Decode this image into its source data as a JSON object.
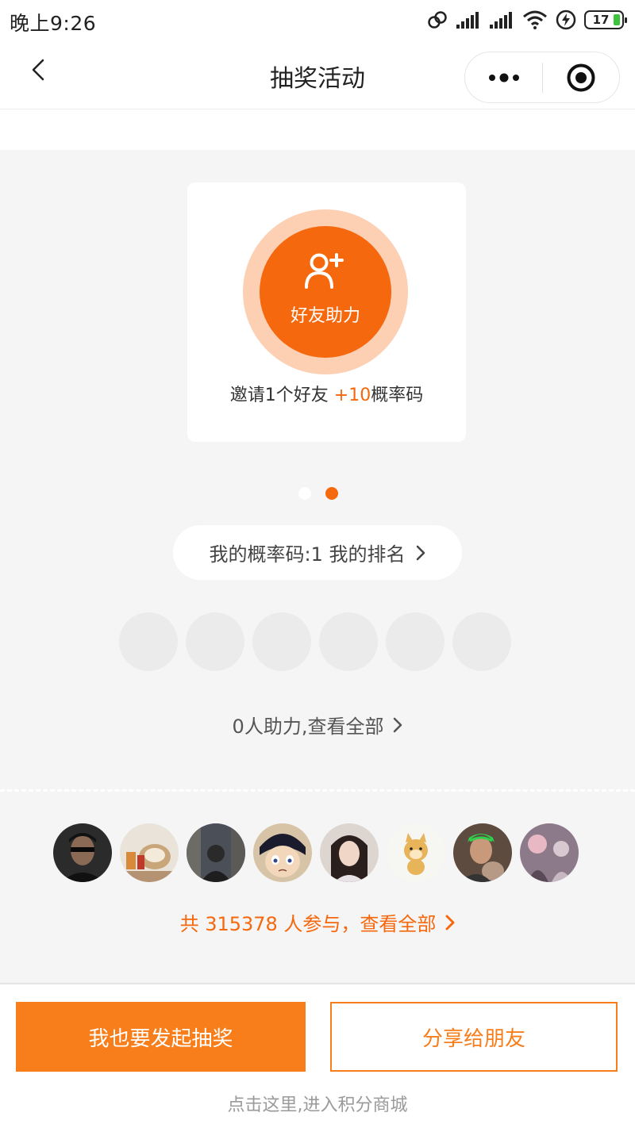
{
  "status_bar": {
    "time": "晚上9:26",
    "battery": "17"
  },
  "nav": {
    "title": "抽奖活动"
  },
  "card": {
    "help_label": "好友助力",
    "note_prefix": "邀请1个好友 ",
    "note_accent": "+10",
    "note_suffix": "概率码"
  },
  "carousel": {
    "count": 2,
    "active": 2
  },
  "rank": {
    "label": "我的概率码:1 我的排名"
  },
  "helpers": {
    "label": "0人助力,查看全部"
  },
  "participants": {
    "label": "共 315378 人参与，查看全部"
  },
  "actions": {
    "primary": "我也要发起抽奖",
    "secondary": "分享给朋友",
    "mall_link": "点击这里,进入积分商城"
  },
  "colors": {
    "accent": "#f5680d",
    "button": "#f77e1b",
    "ring": "#fdd0b4",
    "background": "#f5f5f5"
  }
}
